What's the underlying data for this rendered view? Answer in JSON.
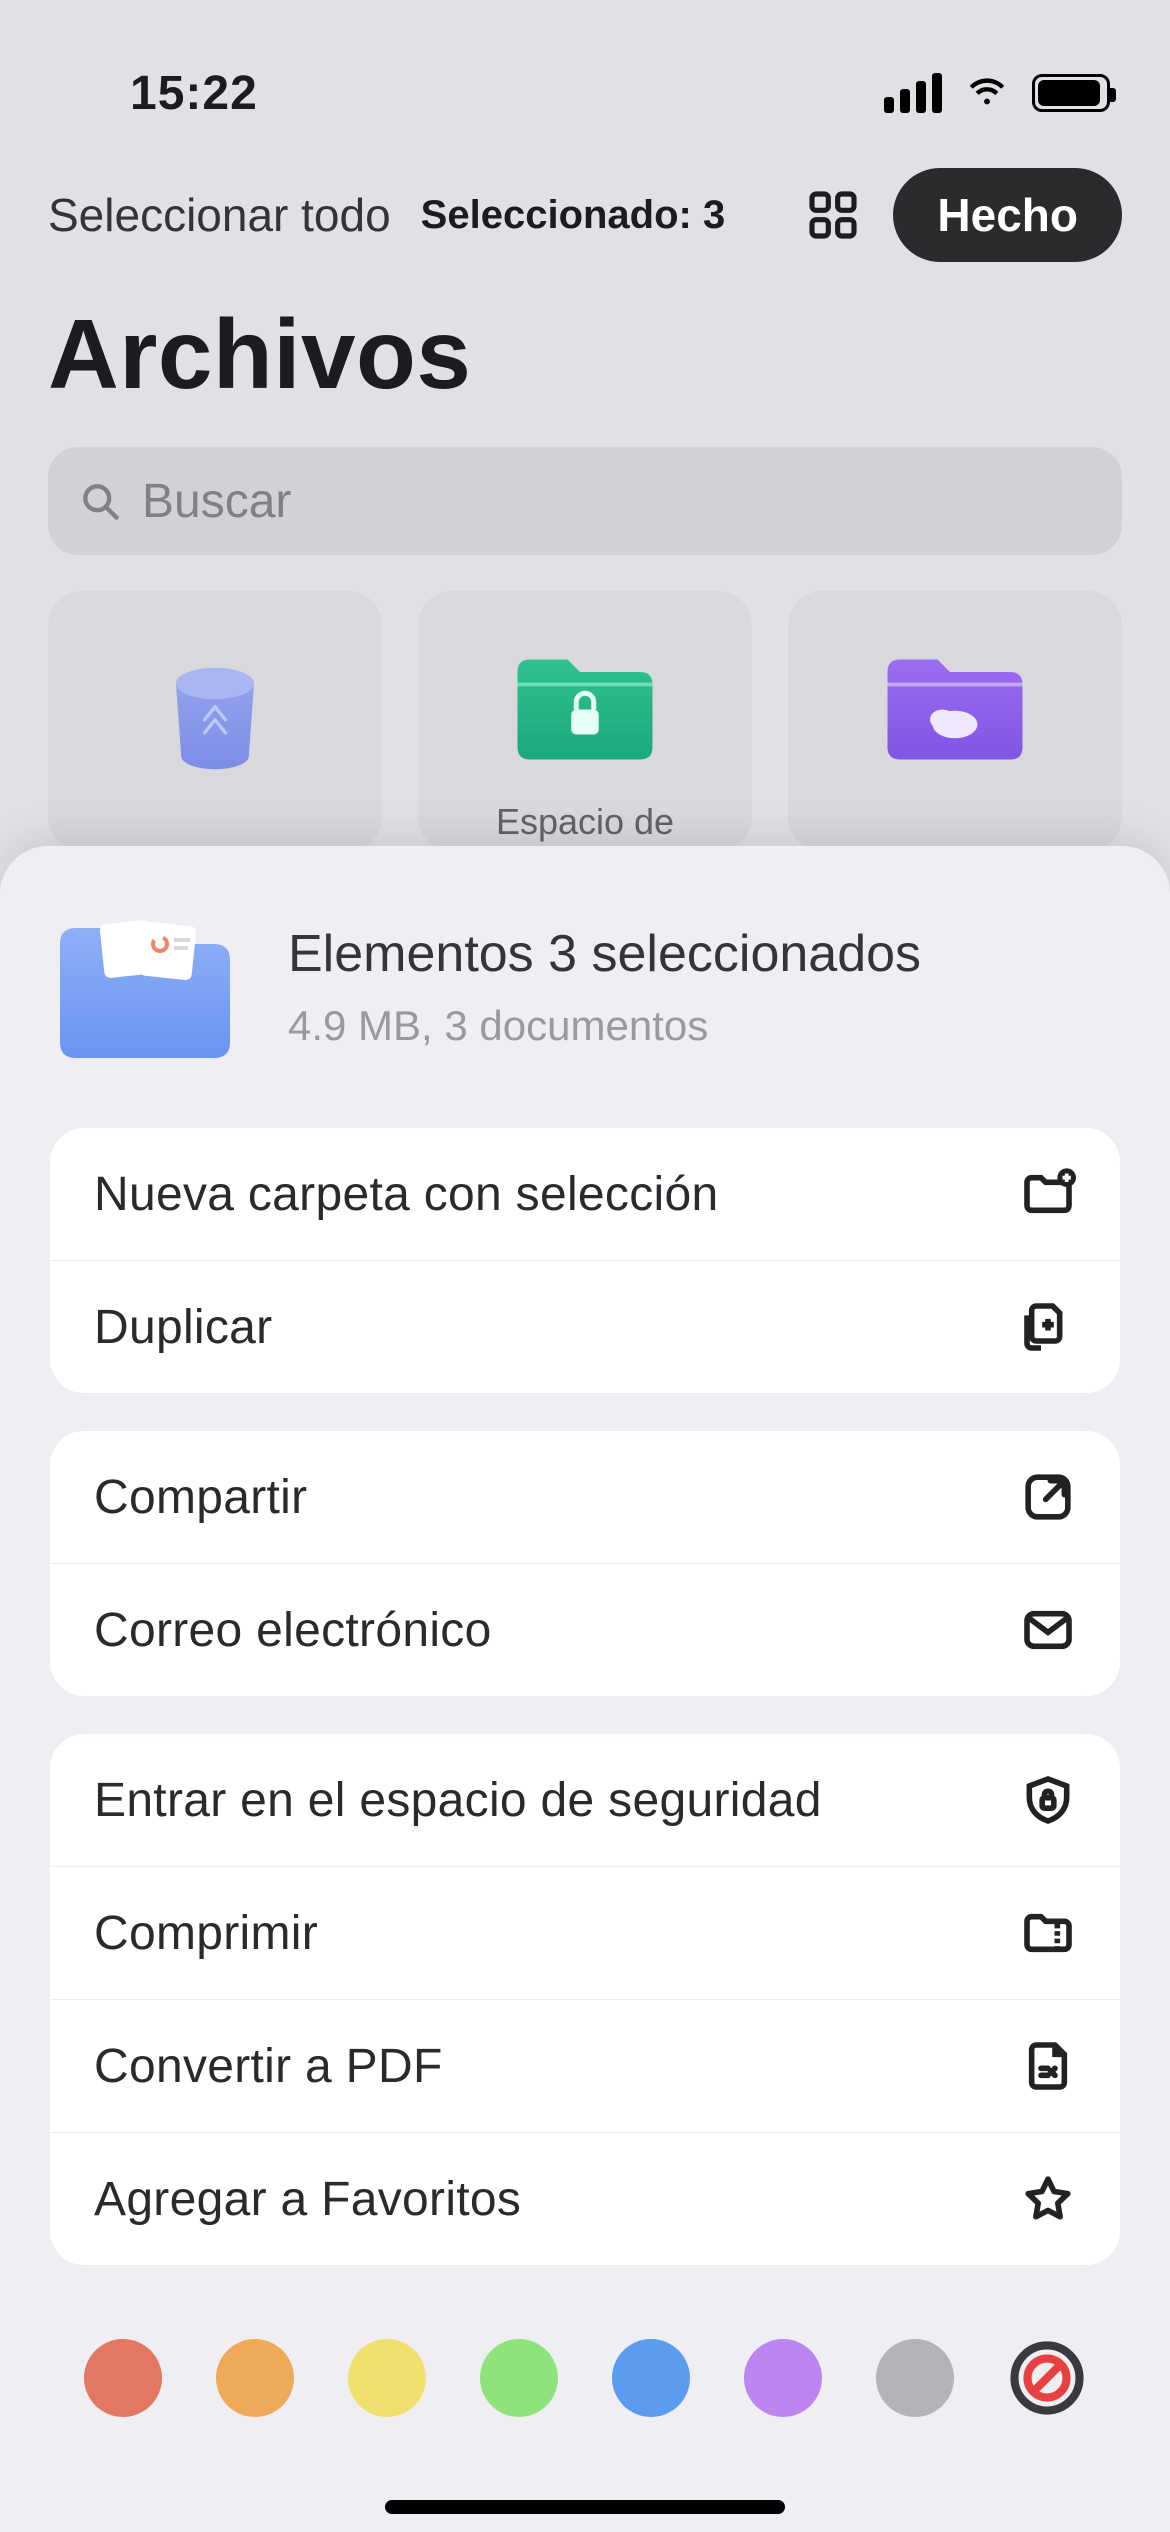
{
  "status": {
    "time": "15:22"
  },
  "toolbar": {
    "select_all": "Seleccionar todo",
    "selected": "Seleccionado: 3",
    "done": "Hecho"
  },
  "title": "Archivos",
  "search": {
    "placeholder": "Buscar"
  },
  "tiles": {
    "trash": "",
    "secure": "Espacio de",
    "cloud": ""
  },
  "sheet": {
    "title": "Elementos 3 seleccionados",
    "subtitle": "4.9 MB, 3 documentos",
    "group1": {
      "newfolder": "Nueva carpeta con selección",
      "duplicate": "Duplicar"
    },
    "group2": {
      "share": "Compartir",
      "email": "Correo electrónico"
    },
    "group3": {
      "secure": "Entrar en el espacio de seguridad",
      "compress": "Comprimir",
      "pdf": "Convertir a PDF",
      "favorite": "Agregar a Favoritos"
    },
    "colors": {
      "red": "#e27763",
      "orange": "#eeaa58",
      "yellow": "#f2e06e",
      "green": "#8ee47a",
      "blue": "#5b9cef",
      "purple": "#bd85f0",
      "grey": "#b3b3b8",
      "none_ring": "#3a3a3e",
      "none_slash": "#e74040"
    }
  }
}
